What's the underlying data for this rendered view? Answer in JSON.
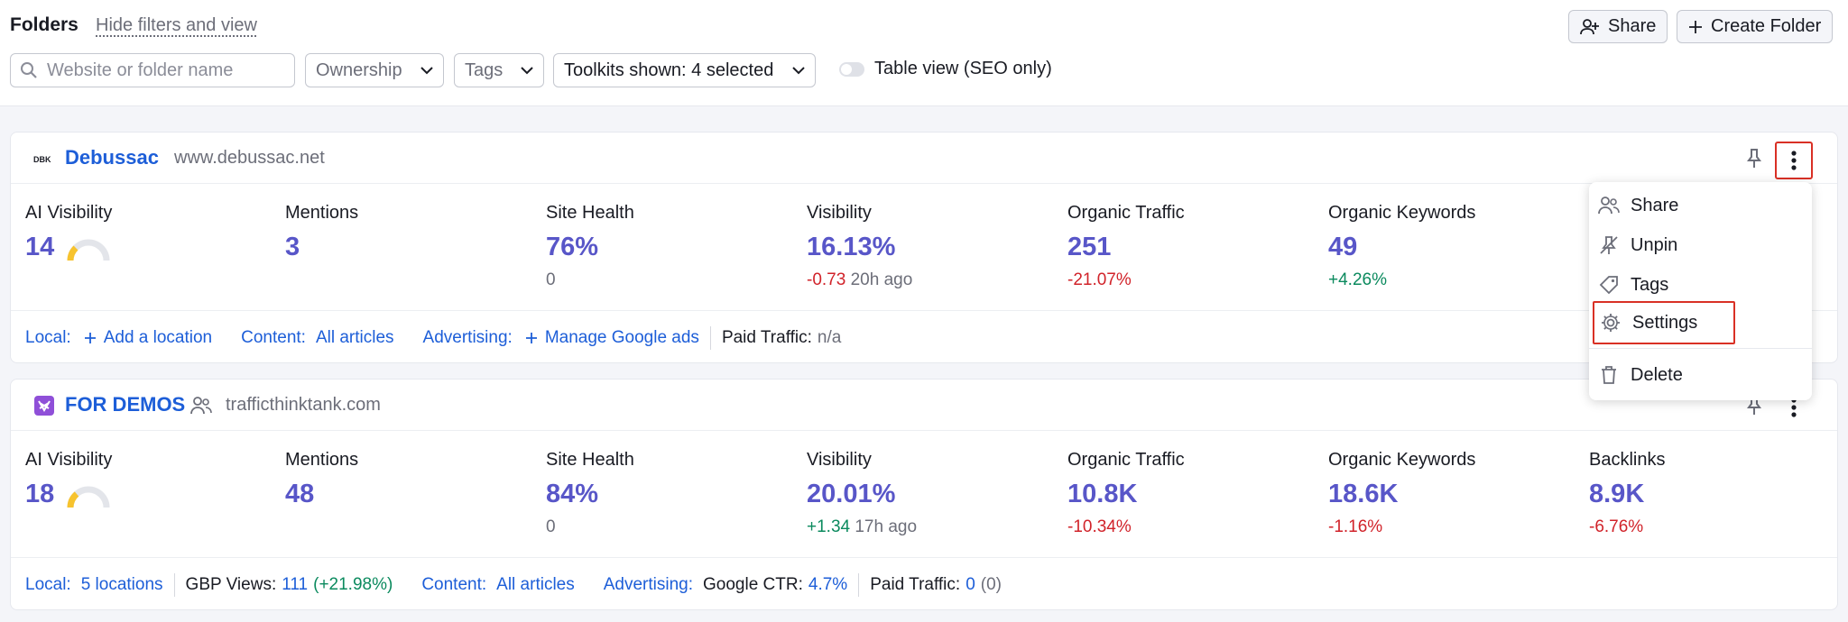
{
  "header": {
    "title": "Folders",
    "hide_link": "Hide filters and view",
    "share_button": "Share",
    "create_button": "Create Folder"
  },
  "filters": {
    "search_placeholder": "Website or folder name",
    "ownership": "Ownership",
    "tags": "Tags",
    "toolkits": "Toolkits shown: 4 selected",
    "table_view": "Table view (SEO only)"
  },
  "cards": [
    {
      "name": "Debussac",
      "url": "www.debussac.net",
      "metrics": {
        "ai_visibility": {
          "label": "AI Visibility",
          "value": "14",
          "level": 0.15
        },
        "mentions": {
          "label": "Mentions",
          "value": "3"
        },
        "site_health": {
          "label": "Site Health",
          "value": "76%",
          "sub": "0"
        },
        "visibility": {
          "label": "Visibility",
          "value": "16.13%",
          "change": "-0.73",
          "time": "20h ago"
        },
        "organic_traffic": {
          "label": "Organic Traffic",
          "value": "251",
          "change": "-21.07%"
        },
        "organic_keywords": {
          "label": "Organic Keywords",
          "value": "49",
          "change": "+4.26%"
        }
      },
      "footer": {
        "local_label": "Local:",
        "local_value": "Add a location",
        "content_label": "Content:",
        "content_value": "All articles",
        "advertising_label": "Advertising:",
        "advertising_value": "Manage Google ads",
        "paid_label": "Paid Traffic:",
        "paid_value": "n/a"
      }
    },
    {
      "name": "FOR DEMOS",
      "url": "trafficthinktank.com",
      "metrics": {
        "ai_visibility": {
          "label": "AI Visibility",
          "value": "18",
          "level": 0.18
        },
        "mentions": {
          "label": "Mentions",
          "value": "48"
        },
        "site_health": {
          "label": "Site Health",
          "value": "84%",
          "sub": "0"
        },
        "visibility": {
          "label": "Visibility",
          "value": "20.01%",
          "change": "+1.34",
          "time": "17h ago"
        },
        "organic_traffic": {
          "label": "Organic Traffic",
          "value": "10.8K",
          "change": "-10.34%"
        },
        "organic_keywords": {
          "label": "Organic Keywords",
          "value": "18.6K",
          "change": "-1.16%"
        },
        "backlinks": {
          "label": "Backlinks",
          "value": "8.9K",
          "change": "-6.76%"
        }
      },
      "footer": {
        "local_label": "Local:",
        "local_value": "5 locations",
        "gbp_label": "GBP Views:",
        "gbp_value": "111",
        "gbp_change": "(+21.98%)",
        "content_label": "Content:",
        "content_value": "All articles",
        "advertising_label": "Advertising:",
        "ctr_label": "Google CTR:",
        "ctr_value": "4.7%",
        "paid_label": "Paid Traffic:",
        "paid_value": "0",
        "paid_extra": "(0)"
      }
    }
  ],
  "menu": {
    "items": [
      "Share",
      "Unpin",
      "Tags",
      "Settings",
      "Delete"
    ]
  },
  "colors": {
    "accent_blue": "#1d5ed8",
    "metric_purple": "#5856c8",
    "negative": "#d1232a",
    "positive": "#0b8a5e",
    "highlight": "#d93025"
  }
}
